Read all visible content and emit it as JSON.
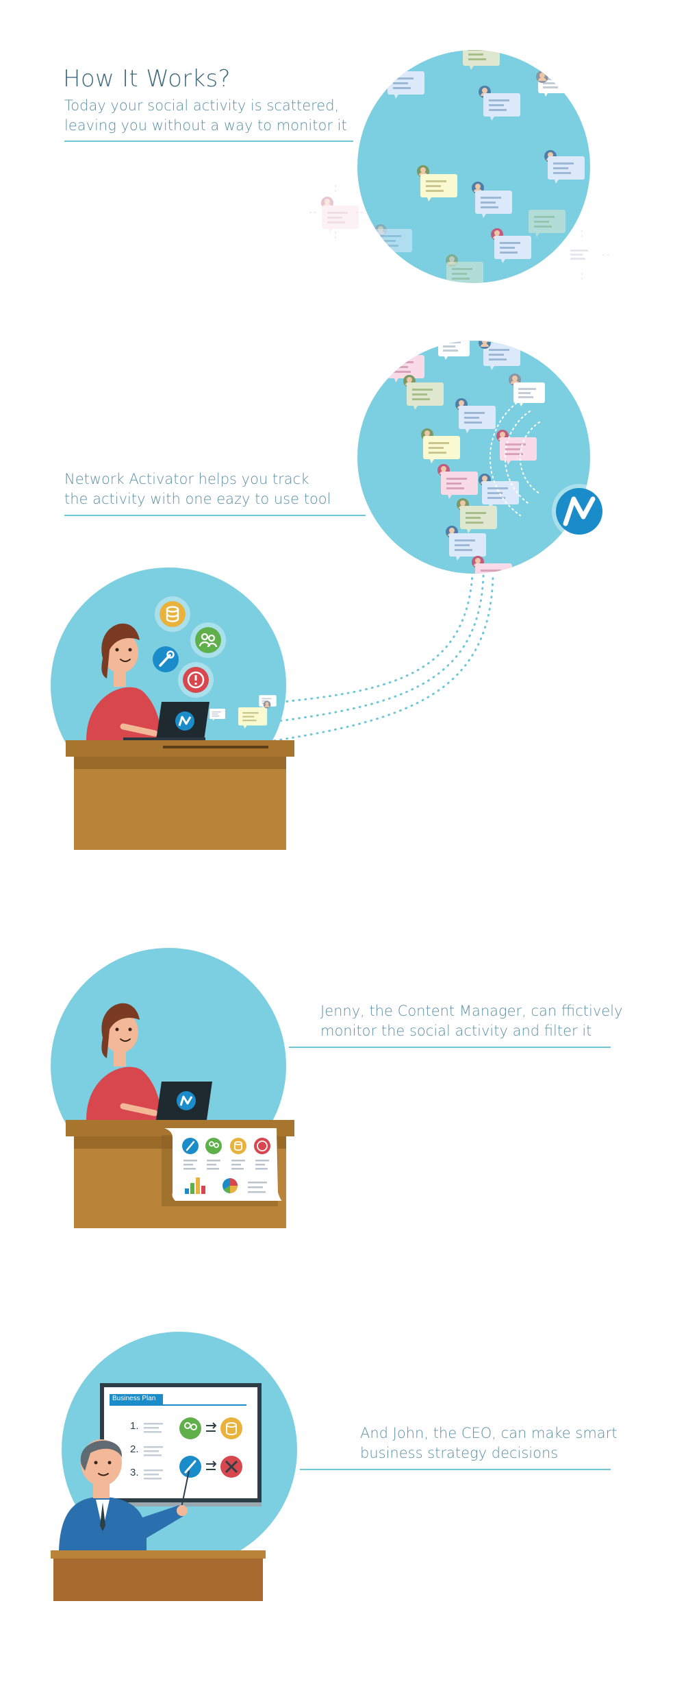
{
  "intro": {
    "title": "How It Works?",
    "line1": "Today your social activity is scattered,",
    "line2": "leaving you without a way to monitor it"
  },
  "tool": {
    "line1": "Network Activator helps you track",
    "line2": "the activity with one eazy to use tool"
  },
  "manager": {
    "line1": "Jenny, the Content Manager, can ffictively",
    "line2": "monitor the social activity and filter it"
  },
  "ceo": {
    "line1": "And John, the CEO, can make smart",
    "line2": "business strategy decisions",
    "board_title": "Business Plan",
    "steps": [
      "1.",
      "2.",
      "3."
    ]
  },
  "colors": {
    "circle": "#7ccfe0",
    "accent_blue": "#1a8cc9",
    "accent_green": "#5fb04a",
    "accent_yellow": "#e9b23c",
    "accent_red": "#d8464e",
    "desk": "#b9843a",
    "desk_top": "#a7752e",
    "rule": "#6fc6d6",
    "text": "#5b8fa3"
  }
}
